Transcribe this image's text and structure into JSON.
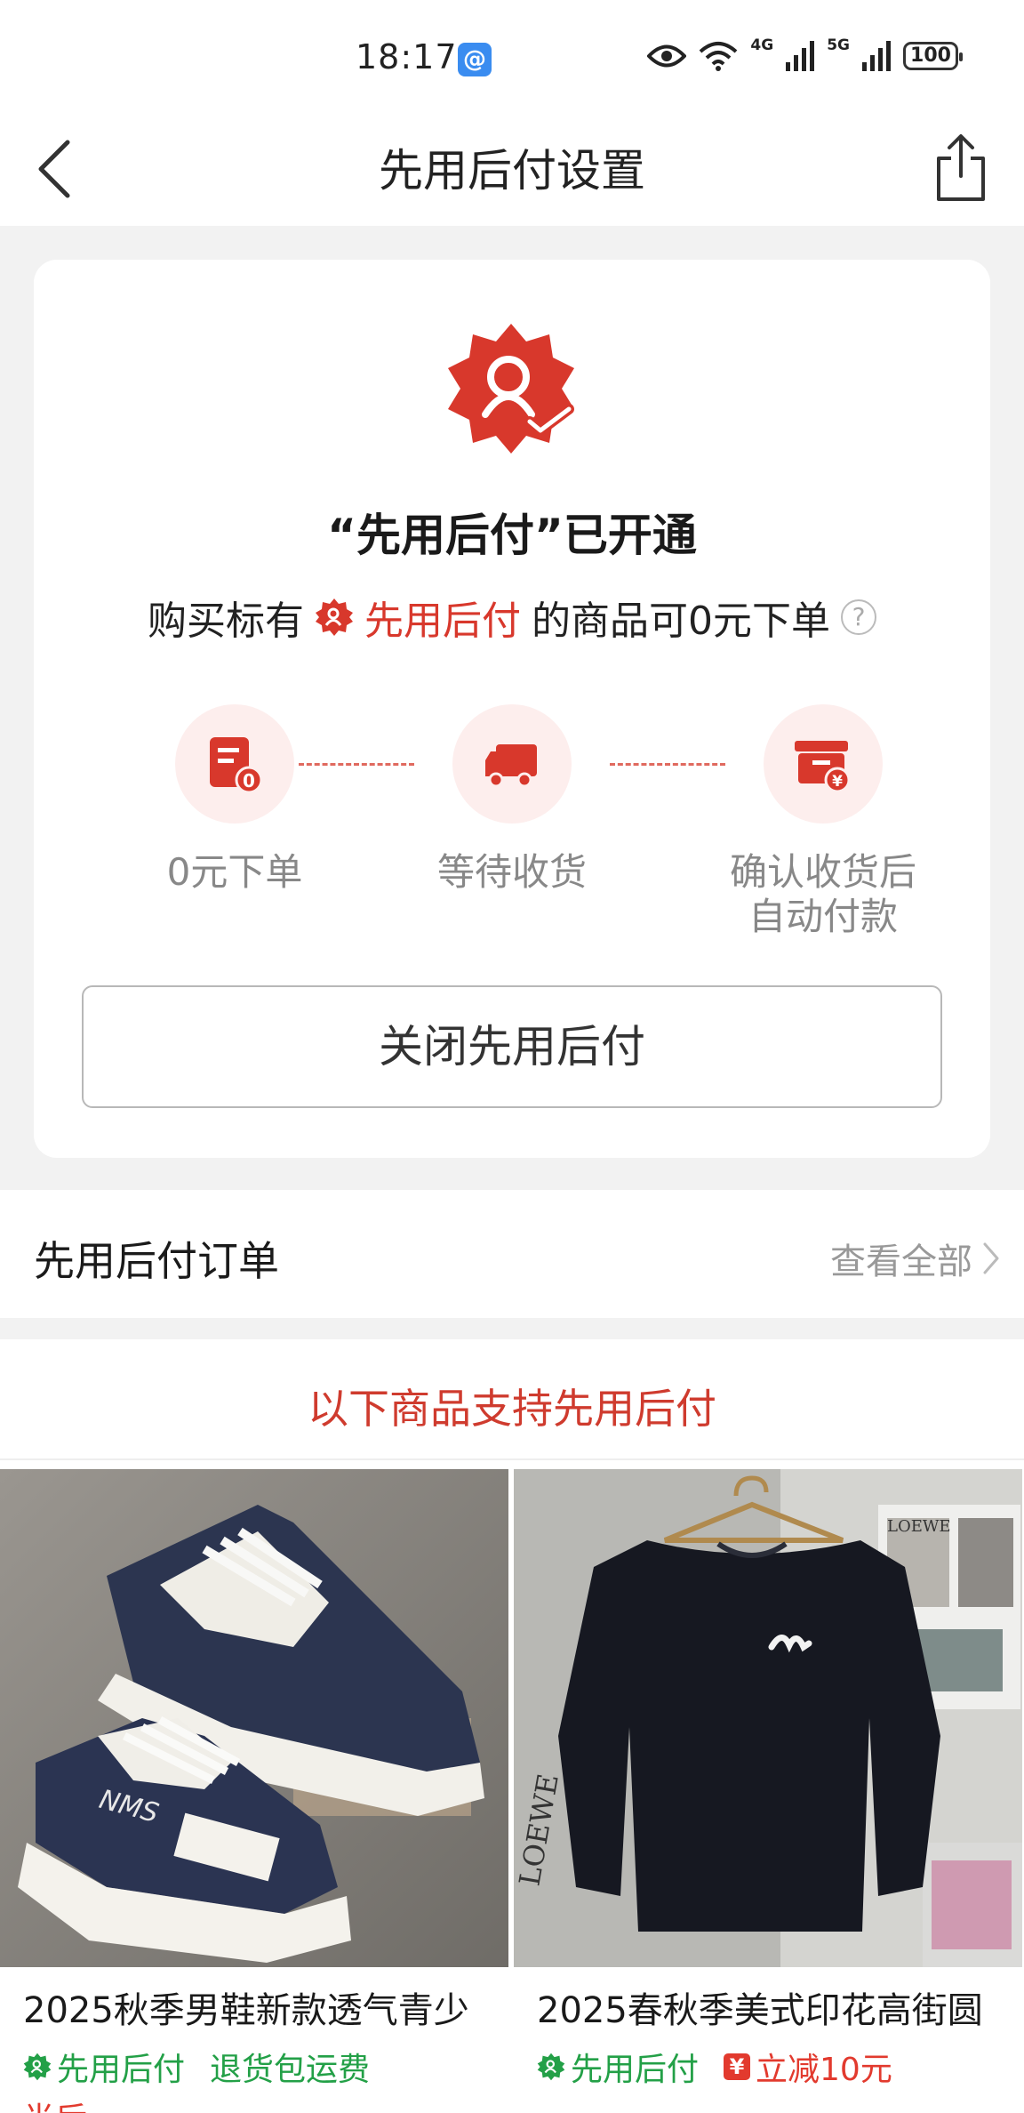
{
  "status_bar": {
    "time": "18:17",
    "app_badge_glyph": "@",
    "network_4g": "4G",
    "network_5g": "5G",
    "battery": "100"
  },
  "nav": {
    "title": "先用后付设置",
    "back_icon": "chevron-left-icon",
    "share_icon": "share-icon"
  },
  "card": {
    "title": "“先用后付”已开通",
    "desc_prefix": "购买标有",
    "desc_highlight": "先用后付",
    "desc_suffix": "的商品可0元下单",
    "help_glyph": "?",
    "steps": [
      {
        "label": "0元下单",
        "icon": "order-zero-icon"
      },
      {
        "label": "等待收货",
        "icon": "delivery-truck-icon"
      },
      {
        "label_line1": "确认收货后",
        "label_line2": "自动付款",
        "icon": "auto-pay-box-icon"
      }
    ],
    "close_button": "关闭先用后付"
  },
  "orders": {
    "title": "先用后付订单",
    "view_all": "查看全部"
  },
  "promo": {
    "title": "以下商品支持先用后付",
    "products": [
      {
        "name": "2025秋季男鞋新款透气青少",
        "tag_pay_later": "先用后付",
        "tag_extra": "退货包运费",
        "overflow_text": "半后"
      },
      {
        "name": "2025春秋季美式印花高街圆",
        "tag_pay_later": "先用后付",
        "coupon_glyph": "¥",
        "tag_discount": "立减10元"
      }
    ]
  },
  "colors": {
    "accent_red": "#d8382c",
    "pay_later_green": "#23a047",
    "discount_red": "#e23a2e"
  }
}
